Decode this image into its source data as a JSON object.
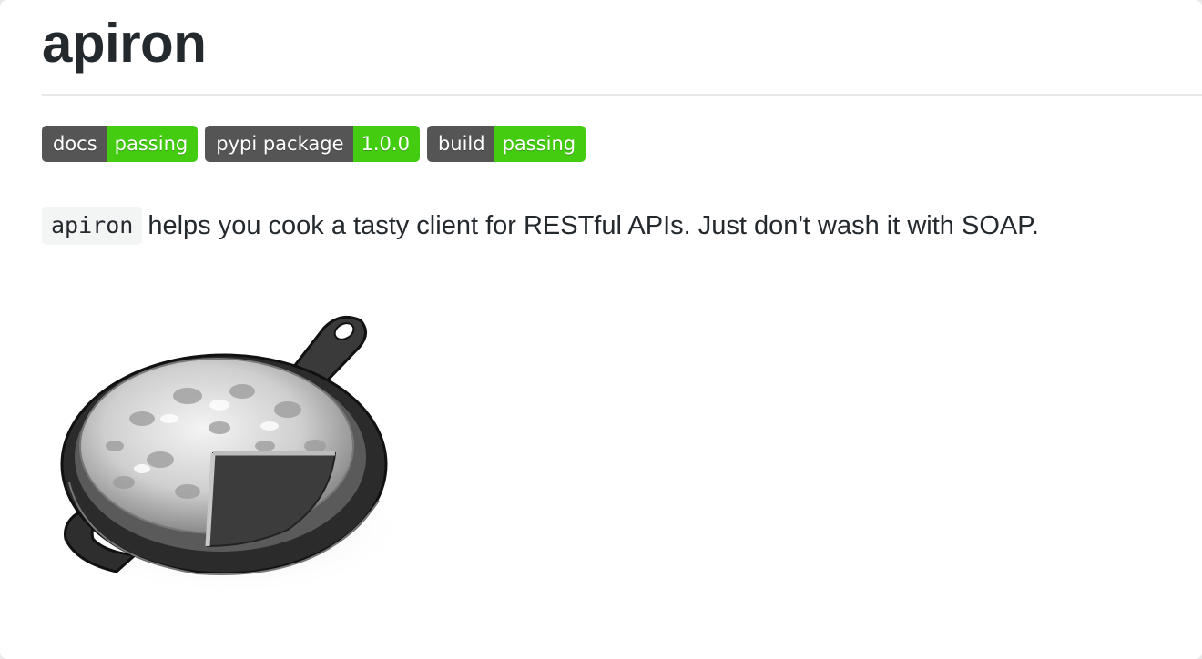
{
  "header": {
    "title": "apiron"
  },
  "badges": [
    {
      "label": "docs",
      "value": "passing"
    },
    {
      "label": "pypi package",
      "value": "1.0.0"
    },
    {
      "label": "build",
      "value": "passing"
    }
  ],
  "description": {
    "code": "apiron",
    "text": "helps you cook a tasty client for RESTful APIs. Just don't wash it with SOAP."
  },
  "colors": {
    "badge_label_bg": "#555555",
    "badge_value_bg": "#44cc11",
    "text": "#24292e"
  },
  "illustration": {
    "icon": "cast-iron-skillet-icon"
  }
}
